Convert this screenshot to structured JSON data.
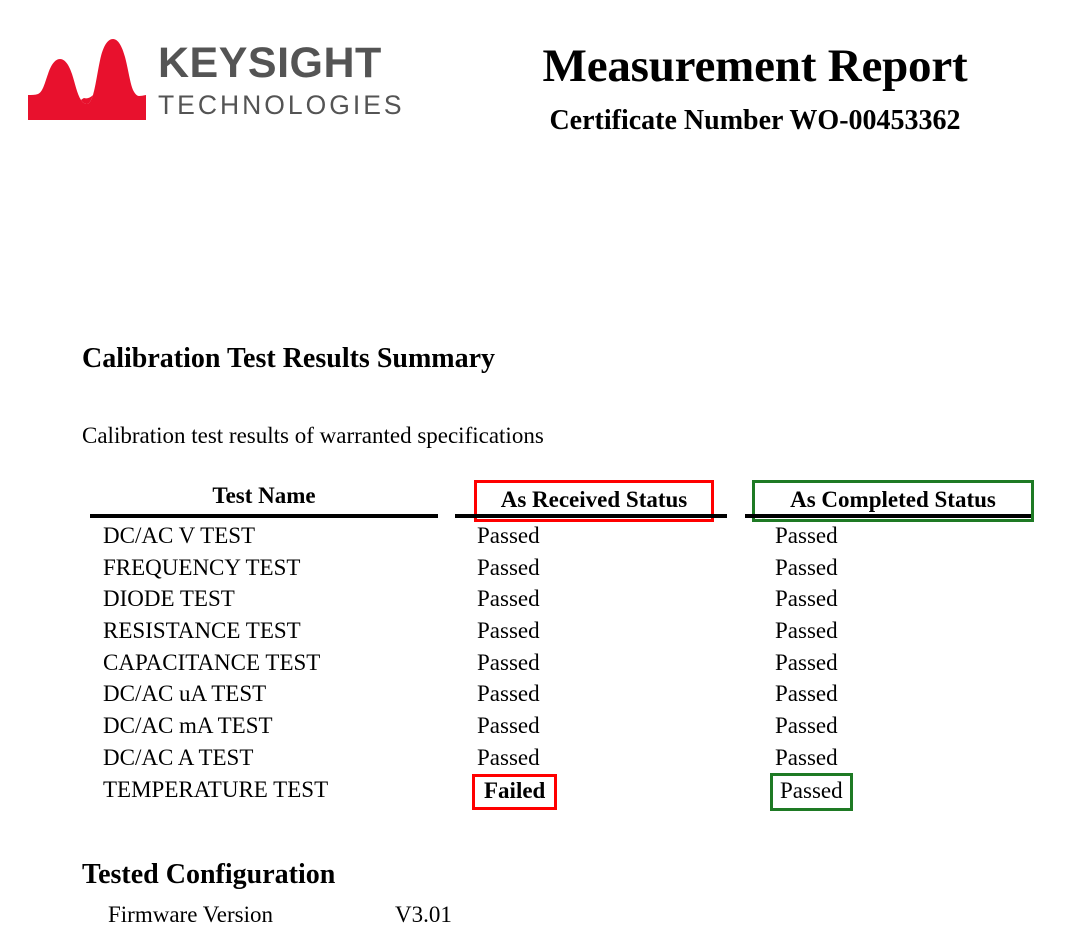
{
  "brand": {
    "logo_icon": "keysight-wave-logo",
    "name": "KEYSIGHT",
    "subtitle": "TECHNOLOGIES",
    "wave_color": "#e8112d",
    "text_color": "#545454"
  },
  "header": {
    "title": "Measurement Report",
    "certificate_line": "Certificate Number WO-00453362"
  },
  "summary": {
    "heading": "Calibration Test Results Summary",
    "description": "Calibration test results of warranted specifications"
  },
  "table": {
    "columns": [
      {
        "label": "Test Name",
        "highlight": "none"
      },
      {
        "label": "As Received Status",
        "highlight": "red"
      },
      {
        "label": "As Completed Status",
        "highlight": "green"
      }
    ],
    "rows": [
      {
        "test_name": "DC/AC V TEST",
        "as_received": "Passed",
        "as_completed": "Passed"
      },
      {
        "test_name": "FREQUENCY TEST",
        "as_received": "Passed",
        "as_completed": "Passed"
      },
      {
        "test_name": "DIODE TEST",
        "as_received": "Passed",
        "as_completed": "Passed"
      },
      {
        "test_name": "RESISTANCE TEST",
        "as_received": "Passed",
        "as_completed": "Passed"
      },
      {
        "test_name": "CAPACITANCE TEST",
        "as_received": "Passed",
        "as_completed": "Passed"
      },
      {
        "test_name": "DC/AC uA TEST",
        "as_received": "Passed",
        "as_completed": "Passed"
      },
      {
        "test_name": "DC/AC mA TEST",
        "as_received": "Passed",
        "as_completed": "Passed"
      },
      {
        "test_name": "DC/AC A TEST",
        "as_received": "Passed",
        "as_completed": "Passed"
      },
      {
        "test_name": "TEMPERATURE TEST",
        "as_received": "Failed",
        "as_completed": "Passed"
      }
    ]
  },
  "configuration": {
    "heading": "Tested Configuration",
    "rows": [
      {
        "label": "Firmware Version",
        "value": "V3.01"
      }
    ]
  },
  "colors": {
    "fail_box": "#ff0000",
    "pass_box": "#1e7a24",
    "rule": "#000000",
    "text": "#000000"
  }
}
